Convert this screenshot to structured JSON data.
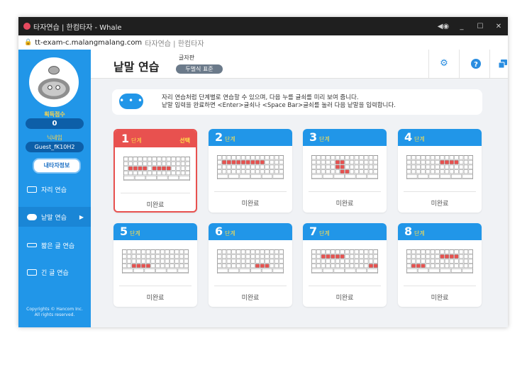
{
  "window": {
    "title": "타자연습 | 한컴타자 - Whale",
    "controls": [
      "◀◉",
      "_",
      "☐",
      "✕"
    ]
  },
  "addressbar": {
    "host": "tt-exam-c.malangmalang.com",
    "page_title": "타자연습 | 한컴타자"
  },
  "sidebar": {
    "score_label": "획득점수",
    "score_value": "0",
    "nick_label": "닉네임",
    "nick_value": "Guest_fK10H2",
    "profile_button": "내타자정보",
    "menu": [
      {
        "label": "자리 연습",
        "icon": "keyboard-icon"
      },
      {
        "label": "낱말 연습",
        "icon": "chat-icon"
      },
      {
        "label": "짧은 글 연습",
        "icon": "short-text-icon"
      },
      {
        "label": "긴 글 연습",
        "icon": "long-text-icon"
      }
    ],
    "copyright": [
      "Copyrights © Hancom Inc.",
      "All rights reserved."
    ]
  },
  "header": {
    "title": "낱말 연습",
    "keyboard_label": "글자판",
    "keyboard_layout": "두벌식 표준",
    "tools": [
      "settings-icon",
      "help-icon",
      "window-icon"
    ]
  },
  "info": {
    "icon_text": "• • •",
    "line1": "자리 연습처럼 단계별로 연습할 수 있으며, 다음 누를 글쇠를 미리 보여 줍니다.",
    "line2": "낱말 입력을 완료하면 <Enter>글쇠나 <Space Bar>글쇠를 눌러 다음 낱말을 입력합니다."
  },
  "stages": [
    {
      "num": "1",
      "unit": "단계",
      "selected_label": "선택",
      "status": "미완료",
      "selected": true
    },
    {
      "num": "2",
      "unit": "단계",
      "status": "미완료"
    },
    {
      "num": "3",
      "unit": "단계",
      "status": "미완료"
    },
    {
      "num": "4",
      "unit": "단계",
      "status": "미완료"
    },
    {
      "num": "5",
      "unit": "단계",
      "status": "미완료"
    },
    {
      "num": "6",
      "unit": "단계",
      "status": "미완료"
    },
    {
      "num": "7",
      "unit": "단계",
      "status": "미완료"
    },
    {
      "num": "8",
      "unit": "단계",
      "status": "미완료"
    }
  ],
  "colors": {
    "primary": "#2196e8",
    "selected": "#e8514f",
    "highlight_key": "#e8514f"
  }
}
